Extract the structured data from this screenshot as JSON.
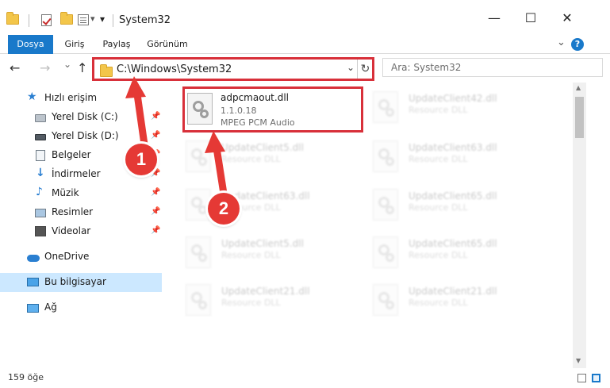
{
  "window": {
    "title": "System32",
    "minimize_glyph": "—",
    "maximize_glyph": "☐",
    "close_glyph": "✕",
    "qat_dropdown_glyph": "▾"
  },
  "ribbon": {
    "tabs": [
      {
        "label": "Dosya"
      },
      {
        "label": "Giriş"
      },
      {
        "label": "Paylaş"
      },
      {
        "label": "Görünüm"
      }
    ],
    "help_glyph": "?",
    "collapse_glyph": "⌄"
  },
  "nav": {
    "back_glyph": "←",
    "forward_glyph": "→",
    "recent_glyph": "⌄",
    "up_glyph": "↑",
    "address": "C:\\Windows\\System32",
    "address_dropdown_glyph": "⌄",
    "refresh_glyph": "↻",
    "search_placeholder": "Ara: System32"
  },
  "sidebar": {
    "pin_glyph": "📌",
    "items": [
      {
        "label": "Hızlı erişim",
        "icon": "star-icon",
        "glyph": "★"
      },
      {
        "label": "Yerel Disk (C:)",
        "icon": "drive-icon"
      },
      {
        "label": "Yerel Disk (D:)",
        "icon": "drive-icon"
      },
      {
        "label": "Belgeler",
        "icon": "documents-icon"
      },
      {
        "label": "İndirmeler",
        "icon": "download-icon",
        "glyph": "↓"
      },
      {
        "label": "Müzik",
        "icon": "music-icon",
        "glyph": "♪"
      },
      {
        "label": "Resimler",
        "icon": "pictures-icon"
      },
      {
        "label": "Videolar",
        "icon": "videos-icon"
      },
      {
        "label": "OneDrive",
        "icon": "cloud-icon"
      },
      {
        "label": "Bu bilgisayar",
        "icon": "computer-icon"
      },
      {
        "label": "Ağ",
        "icon": "network-icon"
      }
    ]
  },
  "files": [
    {
      "name": "adpcmaout.dll",
      "version": "1.1.0.18",
      "description": "MPEG PCM Audio"
    },
    {
      "name": "UpdateClient42.dll",
      "description": "Resource DLL"
    },
    {
      "name": "UpdateClient5.dll",
      "description": "Resource DLL"
    },
    {
      "name": "UpdateClient63.dll",
      "description": "Resource DLL"
    },
    {
      "name": "UpdateClient63.dll",
      "description": "Resource DLL"
    },
    {
      "name": "UpdateClient65.dll",
      "description": "Resource DLL"
    },
    {
      "name": "UpdateClient5.dll",
      "description": "Resource DLL"
    },
    {
      "name": "UpdateClient65.dll",
      "description": "Resource DLL"
    },
    {
      "name": "UpdateClient21.dll",
      "description": "Resource DLL"
    },
    {
      "name": "UpdateClient21.dll",
      "description": "Resource DLL"
    }
  ],
  "scrollbar": {
    "up_glyph": "▲",
    "down_glyph": "▼"
  },
  "status": {
    "item_count": "159 öğe"
  },
  "markers": [
    {
      "label": "1"
    },
    {
      "label": "2"
    }
  ],
  "colors": {
    "accent": "#1979ca",
    "highlight": "#d8303a",
    "marker": "#e53935"
  }
}
